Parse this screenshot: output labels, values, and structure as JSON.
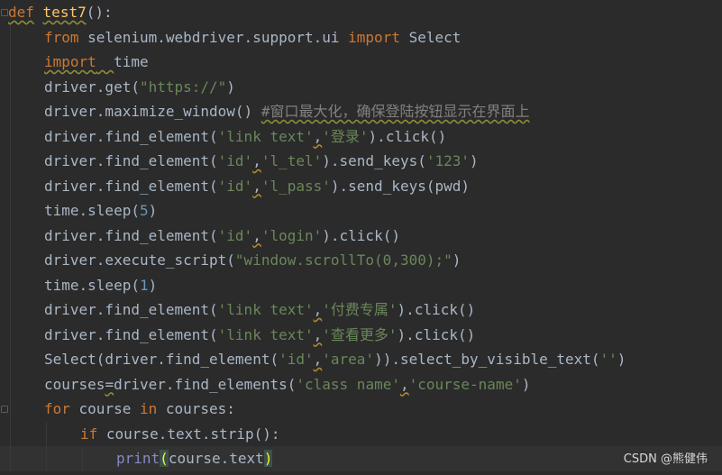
{
  "editor": {
    "lines": [
      {
        "indent": 0,
        "tokens": [
          {
            "t": "def",
            "c": "kw",
            "u": "squiggle"
          },
          {
            "t": " ",
            "c": "plain"
          },
          {
            "t": "test7",
            "c": "fn",
            "u": "squiggle"
          },
          {
            "t": "():",
            "c": "plain"
          }
        ]
      },
      {
        "indent": 1,
        "tokens": [
          {
            "t": "from",
            "c": "kw"
          },
          {
            "t": " selenium.webdriver.support.ui ",
            "c": "plain"
          },
          {
            "t": "import",
            "c": "kw"
          },
          {
            "t": " Select",
            "c": "plain"
          }
        ]
      },
      {
        "indent": 1,
        "tokens": [
          {
            "t": "import",
            "c": "kw",
            "u": "squiggle"
          },
          {
            "t": "  ",
            "c": "plain",
            "u": "squiggle"
          },
          {
            "t": "time",
            "c": "plain"
          }
        ]
      },
      {
        "indent": 1,
        "tokens": [
          {
            "t": "driver.get(",
            "c": "plain"
          },
          {
            "t": "\"https://\"",
            "c": "str"
          },
          {
            "t": ")",
            "c": "plain"
          }
        ]
      },
      {
        "indent": 1,
        "tokens": [
          {
            "t": "driver.maximize_window()",
            "c": "plain"
          },
          {
            "t": " ",
            "c": "plain"
          },
          {
            "t": "#窗口最大化，确保登陆按钮显示在界面上",
            "c": "cmt",
            "u": "squiggle"
          }
        ]
      },
      {
        "indent": 1,
        "tokens": [
          {
            "t": "driver.find_element(",
            "c": "plain"
          },
          {
            "t": "'link text'",
            "c": "str"
          },
          {
            "t": ",",
            "c": "plain",
            "u": "warn"
          },
          {
            "t": "'登录'",
            "c": "str"
          },
          {
            "t": ").click()",
            "c": "plain"
          }
        ]
      },
      {
        "indent": 1,
        "tokens": [
          {
            "t": "driver.find_element(",
            "c": "plain"
          },
          {
            "t": "'id'",
            "c": "str"
          },
          {
            "t": ",",
            "c": "plain",
            "u": "warn"
          },
          {
            "t": "'l_tel'",
            "c": "str"
          },
          {
            "t": ").send_keys(",
            "c": "plain"
          },
          {
            "t": "'123'",
            "c": "str"
          },
          {
            "t": ")",
            "c": "plain"
          }
        ]
      },
      {
        "indent": 1,
        "tokens": [
          {
            "t": "driver.find_element(",
            "c": "plain"
          },
          {
            "t": "'id'",
            "c": "str"
          },
          {
            "t": ",",
            "c": "plain",
            "u": "warn"
          },
          {
            "t": "'l_pass'",
            "c": "str"
          },
          {
            "t": ").send_keys(pwd)",
            "c": "plain"
          }
        ]
      },
      {
        "indent": 1,
        "tokens": [
          {
            "t": "time.sleep(",
            "c": "plain"
          },
          {
            "t": "5",
            "c": "num"
          },
          {
            "t": ")",
            "c": "plain"
          }
        ]
      },
      {
        "indent": 1,
        "tokens": [
          {
            "t": "driver.find_element(",
            "c": "plain"
          },
          {
            "t": "'id'",
            "c": "str"
          },
          {
            "t": ",",
            "c": "plain",
            "u": "warn"
          },
          {
            "t": "'login'",
            "c": "str"
          },
          {
            "t": ").click()",
            "c": "plain"
          }
        ]
      },
      {
        "indent": 1,
        "tokens": [
          {
            "t": "driver.execute_script(",
            "c": "plain"
          },
          {
            "t": "\"window.scrollTo(0,300);\"",
            "c": "str"
          },
          {
            "t": ")",
            "c": "plain"
          }
        ]
      },
      {
        "indent": 1,
        "tokens": [
          {
            "t": "time.sleep(",
            "c": "plain"
          },
          {
            "t": "1",
            "c": "num"
          },
          {
            "t": ")",
            "c": "plain"
          }
        ]
      },
      {
        "indent": 1,
        "tokens": [
          {
            "t": "driver.find_element(",
            "c": "plain"
          },
          {
            "t": "'link text'",
            "c": "str"
          },
          {
            "t": ",",
            "c": "plain",
            "u": "warn"
          },
          {
            "t": "'付费专属'",
            "c": "str"
          },
          {
            "t": ").click()",
            "c": "plain"
          }
        ]
      },
      {
        "indent": 1,
        "tokens": [
          {
            "t": "driver.find_element(",
            "c": "plain"
          },
          {
            "t": "'link text'",
            "c": "str"
          },
          {
            "t": ",",
            "c": "plain",
            "u": "warn"
          },
          {
            "t": "'查看更多'",
            "c": "str"
          },
          {
            "t": ").click()",
            "c": "plain"
          }
        ]
      },
      {
        "indent": 1,
        "tokens": [
          {
            "t": "Select(driver.find_element(",
            "c": "plain"
          },
          {
            "t": "'id'",
            "c": "str"
          },
          {
            "t": ",",
            "c": "plain",
            "u": "warn"
          },
          {
            "t": "'area'",
            "c": "str"
          },
          {
            "t": ")).select_by_visible_text(",
            "c": "plain"
          },
          {
            "t": "''",
            "c": "str"
          },
          {
            "t": ")",
            "c": "plain"
          }
        ]
      },
      {
        "indent": 1,
        "tokens": [
          {
            "t": "courses",
            "c": "plain"
          },
          {
            "t": "=",
            "c": "plain",
            "u": "squiggle"
          },
          {
            "t": "driver.find_elements(",
            "c": "plain"
          },
          {
            "t": "'class name'",
            "c": "str"
          },
          {
            "t": ",",
            "c": "plain",
            "u": "warn"
          },
          {
            "t": "'course-name'",
            "c": "str"
          },
          {
            "t": ")",
            "c": "plain"
          }
        ]
      },
      {
        "indent": 1,
        "tokens": [
          {
            "t": "for",
            "c": "kw"
          },
          {
            "t": " course ",
            "c": "plain"
          },
          {
            "t": "in",
            "c": "kw"
          },
          {
            "t": " courses:",
            "c": "plain"
          }
        ]
      },
      {
        "indent": 2,
        "tokens": [
          {
            "t": "if",
            "c": "kw"
          },
          {
            "t": " course.text.strip():",
            "c": "plain"
          }
        ]
      },
      {
        "indent": 3,
        "current": true,
        "tokens": [
          {
            "t": "print",
            "c": "builtin"
          },
          {
            "t": "(",
            "c": "paren-match"
          },
          {
            "t": "course.text",
            "c": "plain"
          },
          {
            "t": ")",
            "c": "paren-match"
          }
        ]
      }
    ]
  },
  "watermark": "CSDN @熊健伟",
  "colors": {
    "background": "#2b2b2b",
    "keyword": "#cc7832",
    "function": "#ffc66d",
    "string": "#6a8759",
    "number": "#6897bb",
    "comment": "#808080",
    "builtin": "#8888c6",
    "text": "#a9b7c6"
  }
}
